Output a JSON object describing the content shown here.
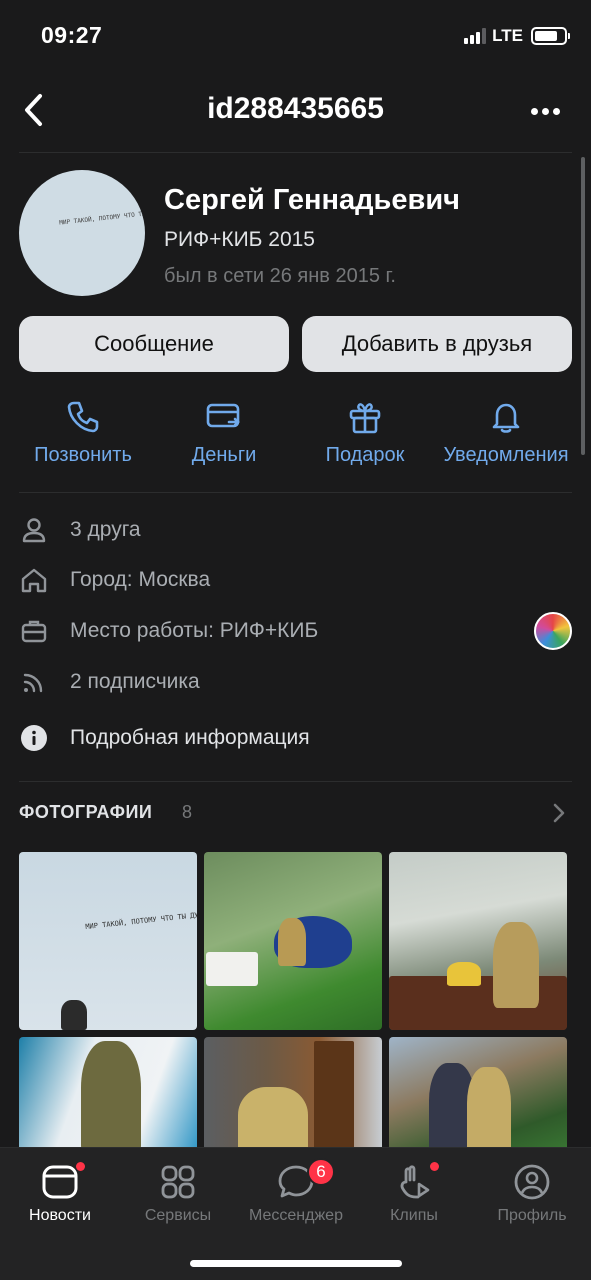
{
  "status_bar": {
    "time": "09:27",
    "network": "LTE"
  },
  "header": {
    "title": "id288435665"
  },
  "profile": {
    "name": "Сергей Геннадьевич",
    "status": "РИФ+КИБ 2015",
    "last_seen": "был в сети 26 янв 2015 г.",
    "avatar_caption": "МИР ТАКОЙ, ПОТОМУ ЧТО ТЫ ДУМАЕШЬ..."
  },
  "buttons": {
    "message": "Сообщение",
    "add_friend": "Добавить в друзья"
  },
  "actions": [
    {
      "label": "Позвонить",
      "icon": "phone-icon"
    },
    {
      "label": "Деньги",
      "icon": "money-transfer-icon"
    },
    {
      "label": "Подарок",
      "icon": "gift-icon"
    },
    {
      "label": "Уведомления",
      "icon": "bell-icon"
    }
  ],
  "info": {
    "friends": "3 друга",
    "city": "Город: Москва",
    "work": "Место работы: РИФ+КИБ",
    "followers": "2 подписчика",
    "details": "Подробная информация"
  },
  "photos": {
    "title": "ФОТОГРАФИИ",
    "count": "8",
    "first_caption": "МИР ТАКОЙ, ПОТОМУ ЧТО ТЫ ДУМАЕШЬ"
  },
  "tabs": [
    {
      "label": "Новости",
      "icon": "news-icon",
      "active": true,
      "dot": true
    },
    {
      "label": "Сервисы",
      "icon": "services-icon",
      "active": false
    },
    {
      "label": "Мессенджер",
      "icon": "messenger-icon",
      "active": false,
      "badge": "6"
    },
    {
      "label": "Клипы",
      "icon": "clips-icon",
      "active": false,
      "dot": true
    },
    {
      "label": "Профиль",
      "icon": "profile-icon",
      "active": false
    }
  ],
  "colors": {
    "background": "#1a1a1b",
    "accent": "#71aaeb",
    "badge": "#ff3347"
  }
}
